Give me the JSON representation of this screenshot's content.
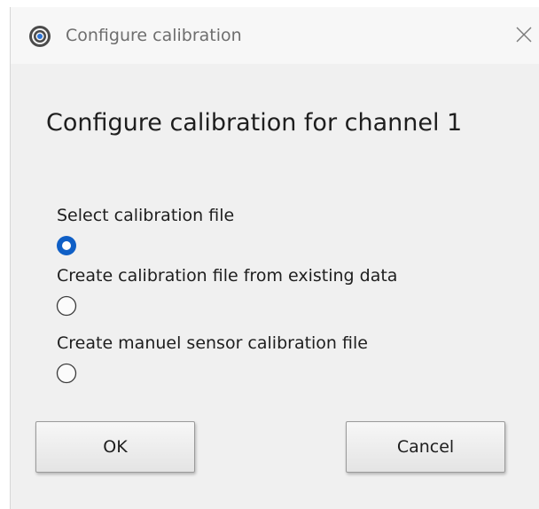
{
  "window": {
    "title": "Configure calibration",
    "app_icon": "calibration-target-icon",
    "close_icon": "close-icon"
  },
  "dialog": {
    "heading": "Configure calibration for channel 1",
    "options": [
      {
        "label": "Select calibration file",
        "selected": true
      },
      {
        "label": "Create calibration file from existing data",
        "selected": false
      },
      {
        "label": "Create manuel sensor calibration file",
        "selected": false
      }
    ],
    "ok_label": "OK",
    "cancel_label": "Cancel"
  },
  "colors": {
    "radio_selected": "#0f5fc6",
    "radio_border": "#3a3a3a"
  }
}
